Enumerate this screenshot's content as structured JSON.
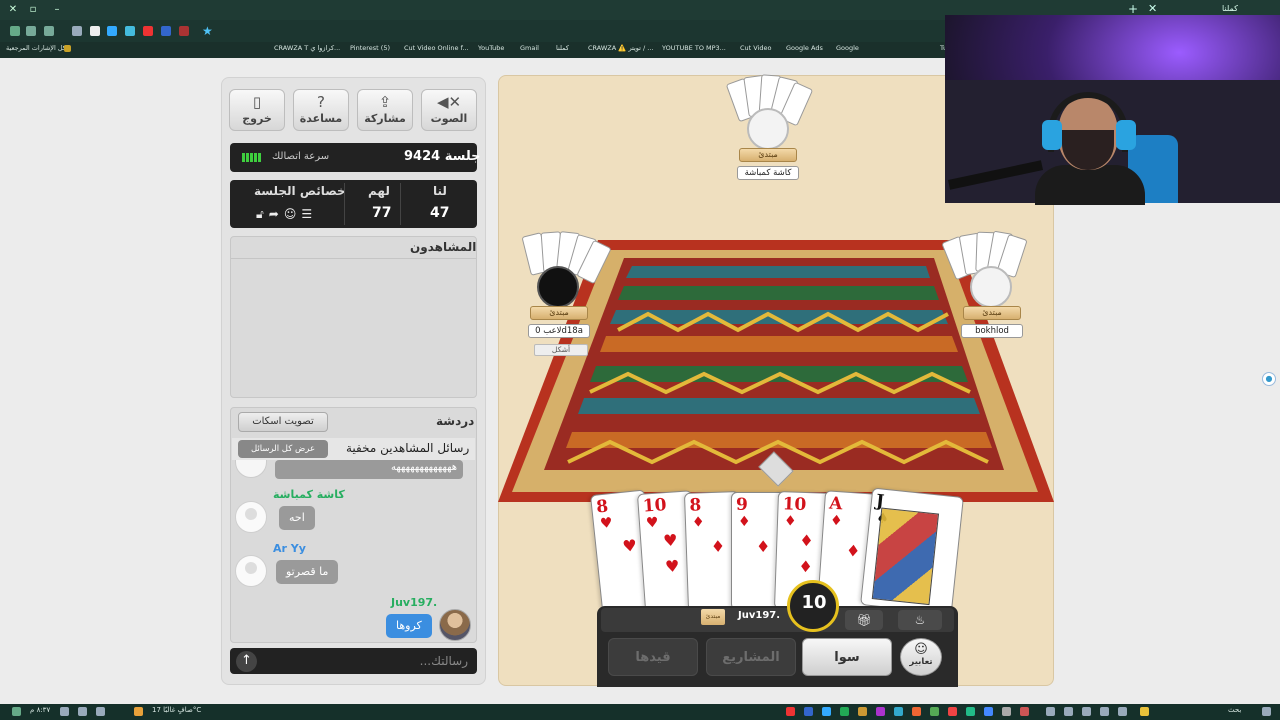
{
  "browser": {
    "tab_title": "كملنا",
    "bookmarks_all": "كل الإشارات المرجعية",
    "bookmarks": [
      "CRAWZA T كرازوا ي...",
      "Pinterest (5)",
      "Cut Video Online f...",
      "YouTube",
      "Gmail",
      "كملنا",
      "CRAWZA ⚠️ تويتر / ...",
      "YOUTUBE TO MP3...",
      "Cut Video",
      "Google Ads",
      "Google",
      "Tu"
    ]
  },
  "toolbar_buttons": {
    "exit": "خروج",
    "help": "مساعدة",
    "share": "مشاركة",
    "sound": "الصوت"
  },
  "session": {
    "connection_label": "سرعة اتصالك",
    "session_label": "جلسة 9424"
  },
  "scores": {
    "us_label": "لنا",
    "them_label": "لهم",
    "props_label": "خصائص الجلسة",
    "us_value": "47",
    "them_value": "77"
  },
  "viewers": {
    "title": "المشاهدون"
  },
  "chat": {
    "title": "دردشة",
    "mute_vote": "تصويت اسكات",
    "hidden_notice": "رسائل المشاهدين مخفية",
    "show_all": "عرض كل الرسائل",
    "messages": [
      {
        "name": "",
        "text": "هههههههههههههه"
      },
      {
        "name": "كاشة كمباشة",
        "text": "احه",
        "color": "#27ae60"
      },
      {
        "name": "Ar Yy",
        "text": "ما قصرتو",
        "color": "#3b8ee0"
      },
      {
        "name": "Juv197.",
        "text": "كروها",
        "color": "#27ae60"
      }
    ],
    "input_placeholder": "رسالتك..."
  },
  "seats": {
    "top": {
      "badge": "مبتدئ",
      "name": "كاشة كمباشة"
    },
    "left": {
      "badge": "مبتدئ",
      "name": "لاعب 0d18a",
      "status": "أشكل"
    },
    "right": {
      "badge": "مبتدئ",
      "name": "bokhlod"
    }
  },
  "hand": [
    {
      "rank": "8",
      "suit": "♥",
      "color": "red"
    },
    {
      "rank": "10",
      "suit": "♥",
      "color": "red"
    },
    {
      "rank": "8",
      "suit": "♦",
      "color": "red"
    },
    {
      "rank": "9",
      "suit": "♦",
      "color": "red"
    },
    {
      "rank": "10",
      "suit": "♦",
      "color": "red"
    },
    {
      "rank": "A",
      "suit": "♦",
      "color": "red"
    },
    {
      "rank": "J",
      "suit": "♠",
      "color": "blk"
    }
  ],
  "me": {
    "badge": "مبتدئ",
    "name": "Juv197.",
    "timer": "10"
  },
  "actions": {
    "qaydha": "قيدها",
    "projects": "المشاريع",
    "sawa": "سوا",
    "emotes": "تعابير"
  },
  "taskbar": {
    "weather": "صافٍ غالبًا 17°C",
    "search": "بحث",
    "time": "٨:٣٧ م"
  },
  "colors": {
    "chrome": "#1f3b34",
    "panel": "#e3e3e3",
    "dark_bar": "#222222",
    "game_bg": "#efdfbf",
    "me_bubble": "#3b8ee0",
    "timer_ring": "#e6c11e"
  }
}
